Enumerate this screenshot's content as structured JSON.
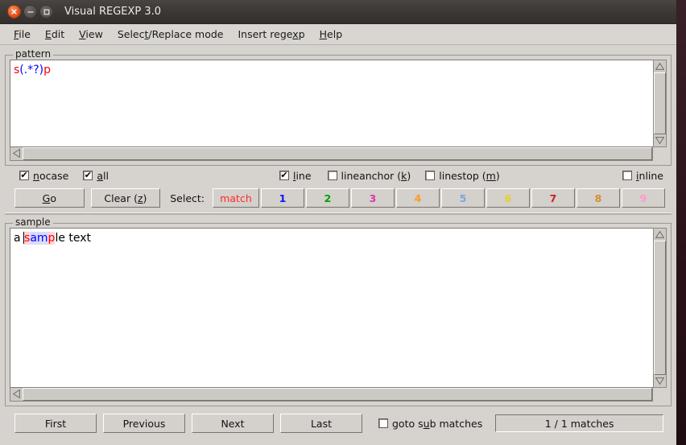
{
  "window": {
    "title": "Visual REGEXP 3.0",
    "buttons": {
      "close": "close-button",
      "minimize": "minimize-button",
      "maximize": "maximize-button"
    }
  },
  "menubar": {
    "items": [
      {
        "label": "File",
        "mnemonic_index": 0
      },
      {
        "label": "Edit",
        "mnemonic_index": 0
      },
      {
        "label": "View",
        "mnemonic_index": 0
      },
      {
        "label": "Select/Replace mode",
        "mnemonic_index": 6
      },
      {
        "label": "Insert regexp",
        "mnemonic_index": 11
      },
      {
        "label": "Help",
        "mnemonic_index": 0
      }
    ]
  },
  "pattern_group": {
    "label": "pattern",
    "value": "s(.*?)p",
    "segments": [
      {
        "text": "s",
        "color": "#ff0000"
      },
      {
        "text": "(.*?)",
        "color": "#0000ff"
      },
      {
        "text": "p",
        "color": "#ff0000"
      }
    ]
  },
  "options": {
    "nocase": {
      "label": "nocase",
      "checked": true,
      "mnemonic_index": 0
    },
    "all": {
      "label": "all",
      "checked": true,
      "mnemonic_index": 0
    },
    "line": {
      "label": "line",
      "checked": true,
      "mnemonic_index": 0
    },
    "lineanchor": {
      "label": "lineanchor (k)",
      "checked": false,
      "mnemonic_index": 12
    },
    "linestop": {
      "label": "linestop (m)",
      "checked": false,
      "mnemonic_index": 10
    },
    "inline": {
      "label": "inline",
      "checked": false,
      "mnemonic_index": 0
    }
  },
  "actions": {
    "go": {
      "label": "Go",
      "mnemonic_index": 0
    },
    "clear": {
      "label": "Clear (z)",
      "mnemonic_index": 7
    },
    "select_label": "Select:",
    "select_buttons": [
      {
        "label": "match",
        "color": "#ff2a2a"
      },
      {
        "label": "1",
        "color": "#1414ff"
      },
      {
        "label": "2",
        "color": "#00a000"
      },
      {
        "label": "3",
        "color": "#e032b4"
      },
      {
        "label": "4",
        "color": "#f5a023"
      },
      {
        "label": "5",
        "color": "#78a8e0"
      },
      {
        "label": "6",
        "color": "#e8d028"
      },
      {
        "label": "7",
        "color": "#d02020"
      },
      {
        "label": "8",
        "color": "#d09030"
      },
      {
        "label": "9",
        "color": "#ff9ad0"
      }
    ]
  },
  "sample_group": {
    "label": "sample",
    "text": "a sample text",
    "segments": [
      {
        "text": "a ",
        "color": "#000000",
        "background": "transparent",
        "caret_after": true
      },
      {
        "text": "s",
        "color": "#ff0000",
        "background": "#ffd6dc"
      },
      {
        "text": "am",
        "color": "#0000ff",
        "background": "#dcdcfb"
      },
      {
        "text": "p",
        "color": "#ff0000",
        "background": "#ffd6dc"
      },
      {
        "text": "le text",
        "color": "#000000",
        "background": "transparent"
      }
    ]
  },
  "navigation": {
    "first": "First",
    "previous": "Previous",
    "next": "Next",
    "last": "Last",
    "goto_sub_matches": {
      "label": "goto sub matches",
      "checked": false,
      "mnemonic_index": 7
    },
    "status": "1 / 1 matches"
  },
  "icons": {
    "scroll_up": "scroll-up-arrow-icon",
    "scroll_down": "scroll-down-arrow-icon",
    "scroll_left": "scroll-left-arrow-icon",
    "scroll_right": "scroll-right-arrow-icon"
  },
  "colors": {
    "window_bg": "#d6d2cd",
    "titlebar_bg": "#3c3836",
    "close_accent": "#dd4814",
    "text_bg": "#ffffff"
  }
}
